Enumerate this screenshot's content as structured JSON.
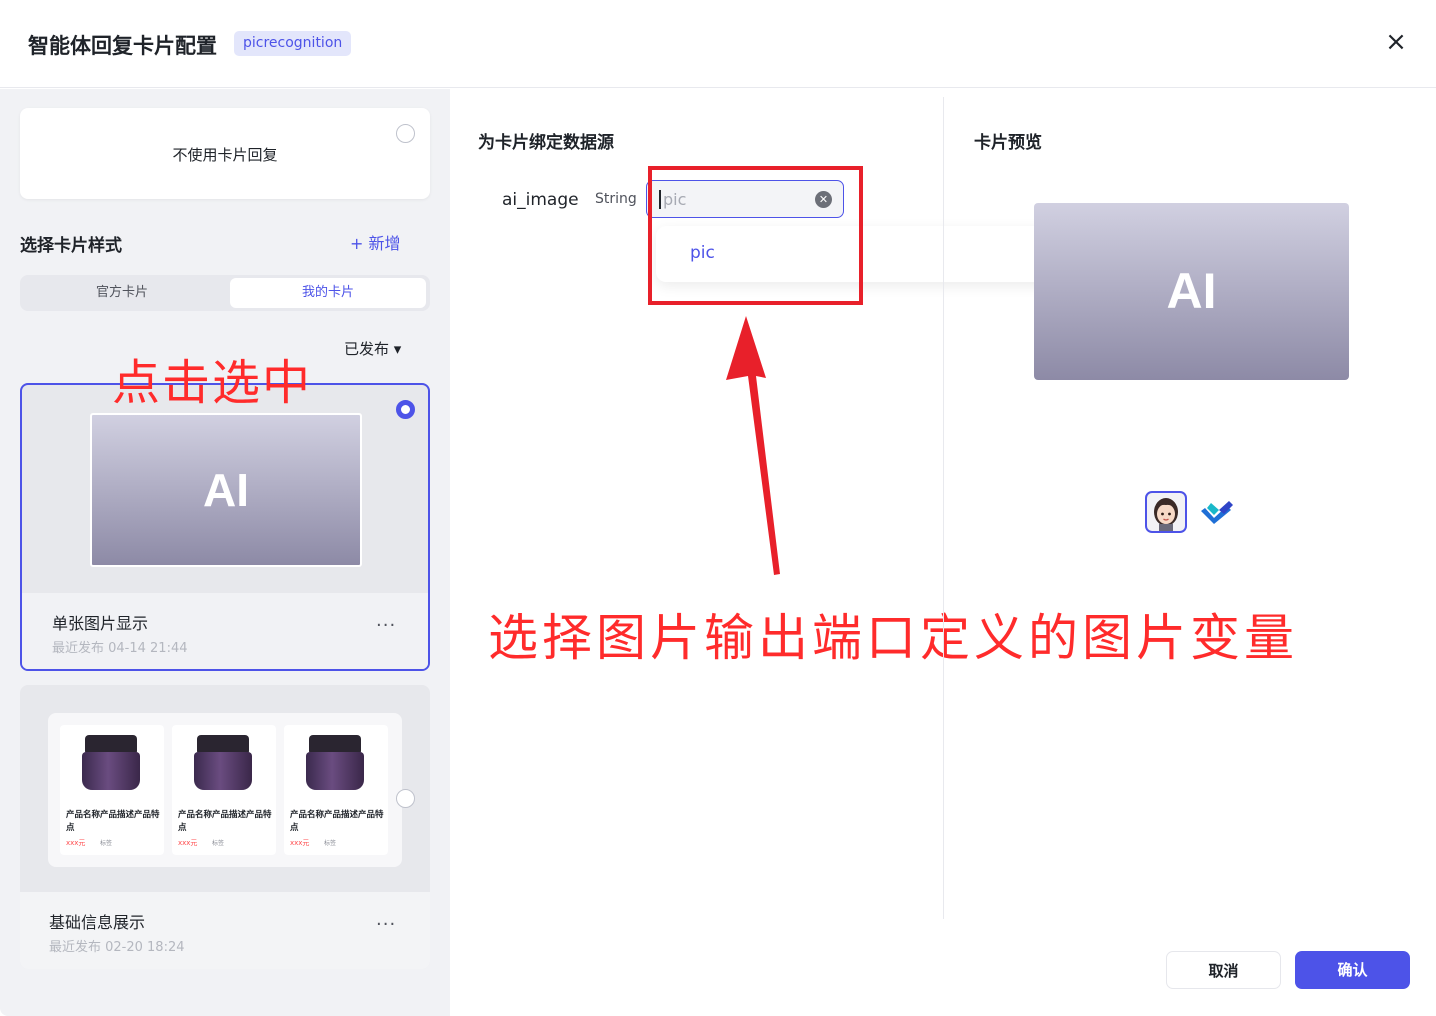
{
  "dialog": {
    "title": "智能体回复卡片配置",
    "workflow_tag": "picrecognition",
    "close_glyph": "×"
  },
  "left_panel": {
    "no_card_label": "不使用卡片回复",
    "style_section_title": "选择卡片样式",
    "add_label": "+ 新增",
    "tabs": [
      {
        "label": "官方卡片",
        "active": false
      },
      {
        "label": "我的卡片",
        "active": true
      }
    ],
    "status_filter": "已发布 ▾",
    "cards": [
      {
        "thumb_text": "AI",
        "name": "单张图片显示",
        "time": "最近发布 04-14 21:44",
        "selected": true,
        "more": "···"
      },
      {
        "name": "基础信息展示",
        "time": "最近发布 02-20 18:24",
        "selected": false,
        "more": "···",
        "products": [
          {
            "title": "产品名称产品描述产品特点",
            "price": "xxx元",
            "tag": "标签"
          },
          {
            "title": "产品名称产品描述产品特点",
            "price": "xxx元",
            "tag": "标签"
          },
          {
            "title": "产品名称产品描述产品特点",
            "price": "xxx元",
            "tag": "标签"
          }
        ]
      }
    ]
  },
  "binding": {
    "title": "为卡片绑定数据源",
    "variable_name": "ai_image",
    "variable_type": "String",
    "input_placeholder": "pic",
    "dropdown_options": [
      "pic"
    ]
  },
  "preview": {
    "title": "卡片预览",
    "thumb_text": "AI"
  },
  "annotations": {
    "click_select": "点击选中",
    "instruction": "选择图片输出端口定义的图片变量"
  },
  "footer": {
    "cancel_label": "取消",
    "confirm_label": "确认"
  },
  "colors": {
    "accent": "#4d53e8",
    "annotation_red": "#ff2b2b",
    "panel_bg": "#f1f2f5"
  }
}
